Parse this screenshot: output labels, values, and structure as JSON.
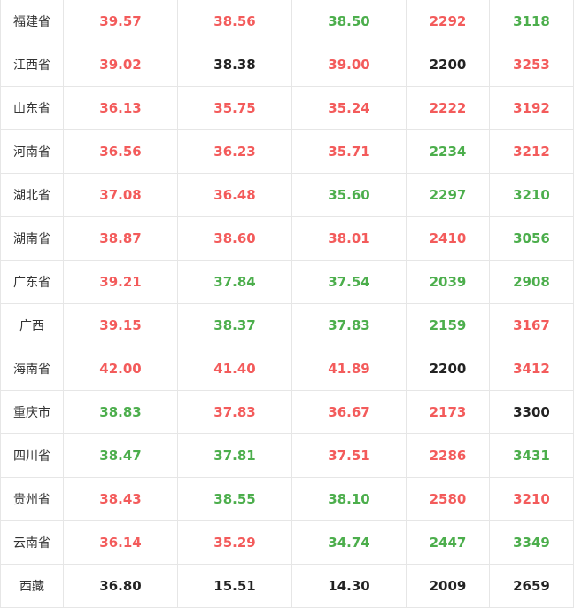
{
  "colors": {
    "up": "#f35b5b",
    "down": "#4cae4c",
    "flat": "#222222",
    "border": "#e6e6e6"
  },
  "rows": [
    {
      "region": "福建省",
      "cells": [
        {
          "v": "39.57",
          "c": "up"
        },
        {
          "v": "38.56",
          "c": "up"
        },
        {
          "v": "38.50",
          "c": "down"
        },
        {
          "v": "2292",
          "c": "up"
        },
        {
          "v": "3118",
          "c": "down"
        }
      ]
    },
    {
      "region": "江西省",
      "cells": [
        {
          "v": "39.02",
          "c": "up"
        },
        {
          "v": "38.38",
          "c": "flat"
        },
        {
          "v": "39.00",
          "c": "up"
        },
        {
          "v": "2200",
          "c": "flat"
        },
        {
          "v": "3253",
          "c": "up"
        }
      ]
    },
    {
      "region": "山东省",
      "cells": [
        {
          "v": "36.13",
          "c": "up"
        },
        {
          "v": "35.75",
          "c": "up"
        },
        {
          "v": "35.24",
          "c": "up"
        },
        {
          "v": "2222",
          "c": "up"
        },
        {
          "v": "3192",
          "c": "up"
        }
      ]
    },
    {
      "region": "河南省",
      "cells": [
        {
          "v": "36.56",
          "c": "up"
        },
        {
          "v": "36.23",
          "c": "up"
        },
        {
          "v": "35.71",
          "c": "up"
        },
        {
          "v": "2234",
          "c": "down"
        },
        {
          "v": "3212",
          "c": "up"
        }
      ]
    },
    {
      "region": "湖北省",
      "cells": [
        {
          "v": "37.08",
          "c": "up"
        },
        {
          "v": "36.48",
          "c": "up"
        },
        {
          "v": "35.60",
          "c": "down"
        },
        {
          "v": "2297",
          "c": "down"
        },
        {
          "v": "3210",
          "c": "down"
        }
      ]
    },
    {
      "region": "湖南省",
      "cells": [
        {
          "v": "38.87",
          "c": "up"
        },
        {
          "v": "38.60",
          "c": "up"
        },
        {
          "v": "38.01",
          "c": "up"
        },
        {
          "v": "2410",
          "c": "up"
        },
        {
          "v": "3056",
          "c": "down"
        }
      ]
    },
    {
      "region": "广东省",
      "cells": [
        {
          "v": "39.21",
          "c": "up"
        },
        {
          "v": "37.84",
          "c": "down"
        },
        {
          "v": "37.54",
          "c": "down"
        },
        {
          "v": "2039",
          "c": "down"
        },
        {
          "v": "2908",
          "c": "down"
        }
      ]
    },
    {
      "region": "广西",
      "cells": [
        {
          "v": "39.15",
          "c": "up"
        },
        {
          "v": "38.37",
          "c": "down"
        },
        {
          "v": "37.83",
          "c": "down"
        },
        {
          "v": "2159",
          "c": "down"
        },
        {
          "v": "3167",
          "c": "up"
        }
      ]
    },
    {
      "region": "海南省",
      "cells": [
        {
          "v": "42.00",
          "c": "up"
        },
        {
          "v": "41.40",
          "c": "up"
        },
        {
          "v": "41.89",
          "c": "up"
        },
        {
          "v": "2200",
          "c": "flat"
        },
        {
          "v": "3412",
          "c": "up"
        }
      ]
    },
    {
      "region": "重庆市",
      "cells": [
        {
          "v": "38.83",
          "c": "down"
        },
        {
          "v": "37.83",
          "c": "up"
        },
        {
          "v": "36.67",
          "c": "up"
        },
        {
          "v": "2173",
          "c": "up"
        },
        {
          "v": "3300",
          "c": "flat"
        }
      ]
    },
    {
      "region": "四川省",
      "cells": [
        {
          "v": "38.47",
          "c": "down"
        },
        {
          "v": "37.81",
          "c": "down"
        },
        {
          "v": "37.51",
          "c": "up"
        },
        {
          "v": "2286",
          "c": "up"
        },
        {
          "v": "3431",
          "c": "down"
        }
      ]
    },
    {
      "region": "贵州省",
      "cells": [
        {
          "v": "38.43",
          "c": "up"
        },
        {
          "v": "38.55",
          "c": "down"
        },
        {
          "v": "38.10",
          "c": "down"
        },
        {
          "v": "2580",
          "c": "up"
        },
        {
          "v": "3210",
          "c": "up"
        }
      ]
    },
    {
      "region": "云南省",
      "cells": [
        {
          "v": "36.14",
          "c": "up"
        },
        {
          "v": "35.29",
          "c": "up"
        },
        {
          "v": "34.74",
          "c": "down"
        },
        {
          "v": "2447",
          "c": "down"
        },
        {
          "v": "3349",
          "c": "down"
        }
      ]
    },
    {
      "region": "西藏",
      "cells": [
        {
          "v": "36.80",
          "c": "flat"
        },
        {
          "v": "15.51",
          "c": "flat"
        },
        {
          "v": "14.30",
          "c": "flat"
        },
        {
          "v": "2009",
          "c": "flat"
        },
        {
          "v": "2659",
          "c": "flat"
        }
      ]
    }
  ]
}
